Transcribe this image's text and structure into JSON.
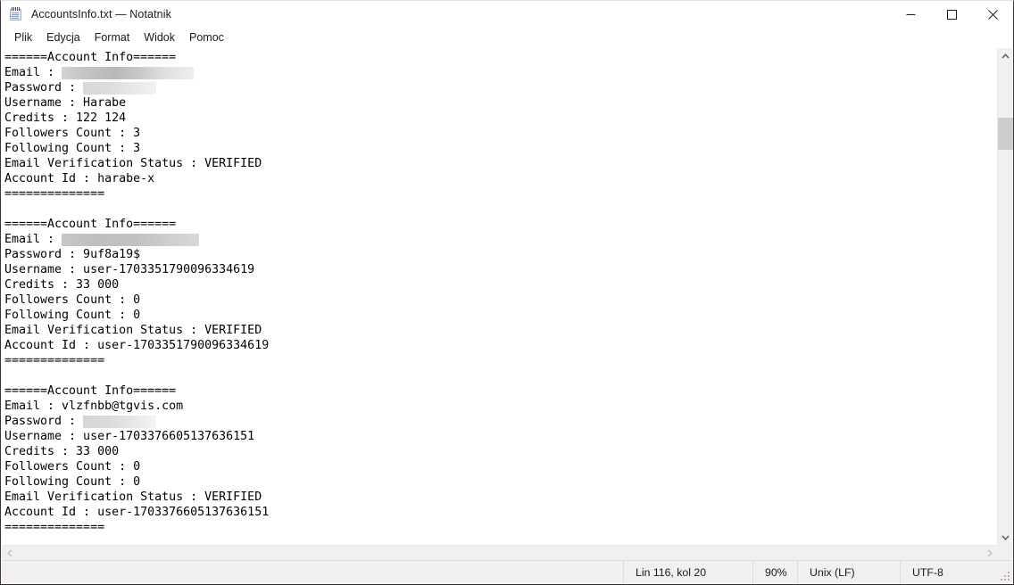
{
  "window": {
    "title": "AccountsInfo.txt — Notatnik",
    "icon": "notepad-icon",
    "controls": {
      "minimize": "minimize-icon",
      "maximize": "maximize-icon",
      "close": "close-icon"
    }
  },
  "menubar": {
    "items": [
      {
        "label": "Plik"
      },
      {
        "label": "Edycja"
      },
      {
        "label": "Format"
      },
      {
        "label": "Widok"
      },
      {
        "label": "Pomoc"
      }
    ]
  },
  "document": {
    "lines": [
      {
        "text": "======Account Info======"
      },
      {
        "text": "Email : ",
        "redact": "r1"
      },
      {
        "text": "Password : ",
        "redact": "r2"
      },
      {
        "text": "Username : Harabe"
      },
      {
        "text": "Credits : 122 124"
      },
      {
        "text": "Followers Count : 3"
      },
      {
        "text": "Following Count : 3"
      },
      {
        "text": "Email Verification Status : VERIFIED"
      },
      {
        "text": "Account Id : harabe-x"
      },
      {
        "text": "=============="
      },
      {
        "text": ""
      },
      {
        "text": "======Account Info======"
      },
      {
        "text": "Email : ",
        "redact": "r3"
      },
      {
        "text": "Password : 9uf8a19$"
      },
      {
        "text": "Username : user-1703351790096334619"
      },
      {
        "text": "Credits : 33 000"
      },
      {
        "text": "Followers Count : 0"
      },
      {
        "text": "Following Count : 0"
      },
      {
        "text": "Email Verification Status : VERIFIED"
      },
      {
        "text": "Account Id : user-1703351790096334619"
      },
      {
        "text": "=============="
      },
      {
        "text": ""
      },
      {
        "text": "======Account Info======"
      },
      {
        "text": "Email : vlzfnbb@tgvis.com"
      },
      {
        "text": "Password : ",
        "redact": "r4"
      },
      {
        "text": "Username : user-1703376605137636151"
      },
      {
        "text": "Credits : 33 000"
      },
      {
        "text": "Followers Count : 0"
      },
      {
        "text": "Following Count : 0"
      },
      {
        "text": "Email Verification Status : VERIFIED"
      },
      {
        "text": "Account Id : user-1703376605137636151"
      },
      {
        "text": "=============="
      }
    ]
  },
  "scrollbars": {
    "vertical": {
      "up_icon": "chevron-up-icon",
      "down_icon": "chevron-down-icon",
      "thumb": "scroll-thumb"
    },
    "horizontal": {
      "left_icon": "chevron-left-icon",
      "right_icon": "chevron-right-icon"
    }
  },
  "statusbar": {
    "position": "Lin 116, kol 20",
    "zoom": "90%",
    "line_ending": "Unix (LF)",
    "encoding": "UTF-8"
  },
  "colors": {
    "window_border": "#4a2b47",
    "chrome": "#f0f0f0",
    "text": "#000000",
    "close_hover": "#e81123"
  }
}
